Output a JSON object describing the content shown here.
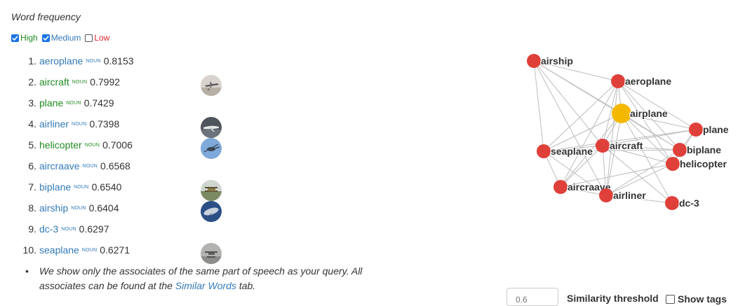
{
  "header": {
    "title": "Word frequency"
  },
  "filters": [
    {
      "label": "High",
      "checked": true,
      "color": "#228b22"
    },
    {
      "label": "Medium",
      "checked": true,
      "color": "#337ab7"
    },
    {
      "label": "Low",
      "checked": false,
      "color": "#d9262c"
    }
  ],
  "results": [
    {
      "num": "1.",
      "word": "aeroplane",
      "pos": "NOUN",
      "score": "0.8153",
      "freq": "medium",
      "thumb": null
    },
    {
      "num": "2.",
      "word": "aircraft",
      "pos": "NOUN",
      "score": "0.7992",
      "freq": "high",
      "thumb": "aircraft-thumbnail"
    },
    {
      "num": "3.",
      "word": "plane",
      "pos": "NOUN",
      "score": "0.7429",
      "freq": "high",
      "thumb": null
    },
    {
      "num": "4.",
      "word": "airliner",
      "pos": "NOUN",
      "score": "0.7398",
      "freq": "medium",
      "thumb": "airliner-thumbnail"
    },
    {
      "num": "5.",
      "word": "helicopter",
      "pos": "NOUN",
      "score": "0.7006",
      "freq": "high",
      "thumb": "helicopter-thumbnail"
    },
    {
      "num": "6.",
      "word": "aircraave",
      "pos": "NOUN",
      "score": "0.6568",
      "freq": "medium",
      "thumb": null
    },
    {
      "num": "7.",
      "word": "biplane",
      "pos": "NOUN",
      "score": "0.6540",
      "freq": "medium",
      "thumb": "biplane-thumbnail"
    },
    {
      "num": "8.",
      "word": "airship",
      "pos": "NOUN",
      "score": "0.6404",
      "freq": "medium",
      "thumb": "airship-thumbnail"
    },
    {
      "num": "9.",
      "word": "dc-3",
      "pos": "NOUN",
      "score": "0.6297",
      "freq": "medium",
      "thumb": null
    },
    {
      "num": "10.",
      "word": "seaplane",
      "pos": "NOUN",
      "score": "0.6271",
      "freq": "medium",
      "thumb": "seaplane-thumbnail"
    }
  ],
  "note": {
    "text": "We show only the associates of the same part of speech as your query. All associates can be found at the ",
    "link": "Similar Words",
    "suffix": " tab."
  },
  "graph": {
    "center_color": "#f5b800",
    "node_color": "#e0403a",
    "nodes": [
      {
        "id": "airplane",
        "label": "airplane",
        "center": true
      },
      {
        "id": "airship",
        "label": "airship"
      },
      {
        "id": "aeroplane",
        "label": "aeroplane"
      },
      {
        "id": "plane",
        "label": "plane"
      },
      {
        "id": "seaplane",
        "label": "seaplane"
      },
      {
        "id": "aircraft",
        "label": "aircraft"
      },
      {
        "id": "biplane",
        "label": "biplane"
      },
      {
        "id": "helicopter",
        "label": "helicopter"
      },
      {
        "id": "aircraave",
        "label": "aircraave"
      },
      {
        "id": "airliner",
        "label": "airliner"
      },
      {
        "id": "dc-3",
        "label": "dc-3"
      }
    ],
    "edges": [
      [
        "airship",
        "aeroplane"
      ],
      [
        "airship",
        "airplane"
      ],
      [
        "airship",
        "aircraft"
      ],
      [
        "airship",
        "seaplane"
      ],
      [
        "airship",
        "airliner"
      ],
      [
        "airship",
        "biplane"
      ],
      [
        "aeroplane",
        "airplane"
      ],
      [
        "aeroplane",
        "aircraft"
      ],
      [
        "aeroplane",
        "plane"
      ],
      [
        "aeroplane",
        "seaplane"
      ],
      [
        "aeroplane",
        "helicopter"
      ],
      [
        "aeroplane",
        "airliner"
      ],
      [
        "aeroplane",
        "biplane"
      ],
      [
        "aeroplane",
        "aircraave"
      ],
      [
        "airplane",
        "plane"
      ],
      [
        "airplane",
        "aircraft"
      ],
      [
        "airplane",
        "seaplane"
      ],
      [
        "airplane",
        "biplane"
      ],
      [
        "airplane",
        "helicopter"
      ],
      [
        "airplane",
        "airliner"
      ],
      [
        "airplane",
        "aircraave"
      ],
      [
        "airplane",
        "dc-3"
      ],
      [
        "plane",
        "biplane"
      ],
      [
        "plane",
        "aircraft"
      ],
      [
        "plane",
        "helicopter"
      ],
      [
        "plane",
        "seaplane"
      ],
      [
        "seaplane",
        "aircraft"
      ],
      [
        "seaplane",
        "biplane"
      ],
      [
        "seaplane",
        "airliner"
      ],
      [
        "seaplane",
        "aircraave"
      ],
      [
        "aircraft",
        "biplane"
      ],
      [
        "aircraft",
        "helicopter"
      ],
      [
        "aircraft",
        "airliner"
      ],
      [
        "aircraft",
        "aircraave"
      ],
      [
        "aircraft",
        "dc-3"
      ],
      [
        "biplane",
        "helicopter"
      ],
      [
        "biplane",
        "airliner"
      ],
      [
        "helicopter",
        "airliner"
      ],
      [
        "helicopter",
        "aircraave"
      ],
      [
        "airliner",
        "aircraave"
      ],
      [
        "airliner",
        "dc-3"
      ]
    ]
  },
  "controls": {
    "threshold_value": "0.6",
    "threshold_label": "Similarity threshold",
    "show_tags_label": "Show tags"
  }
}
